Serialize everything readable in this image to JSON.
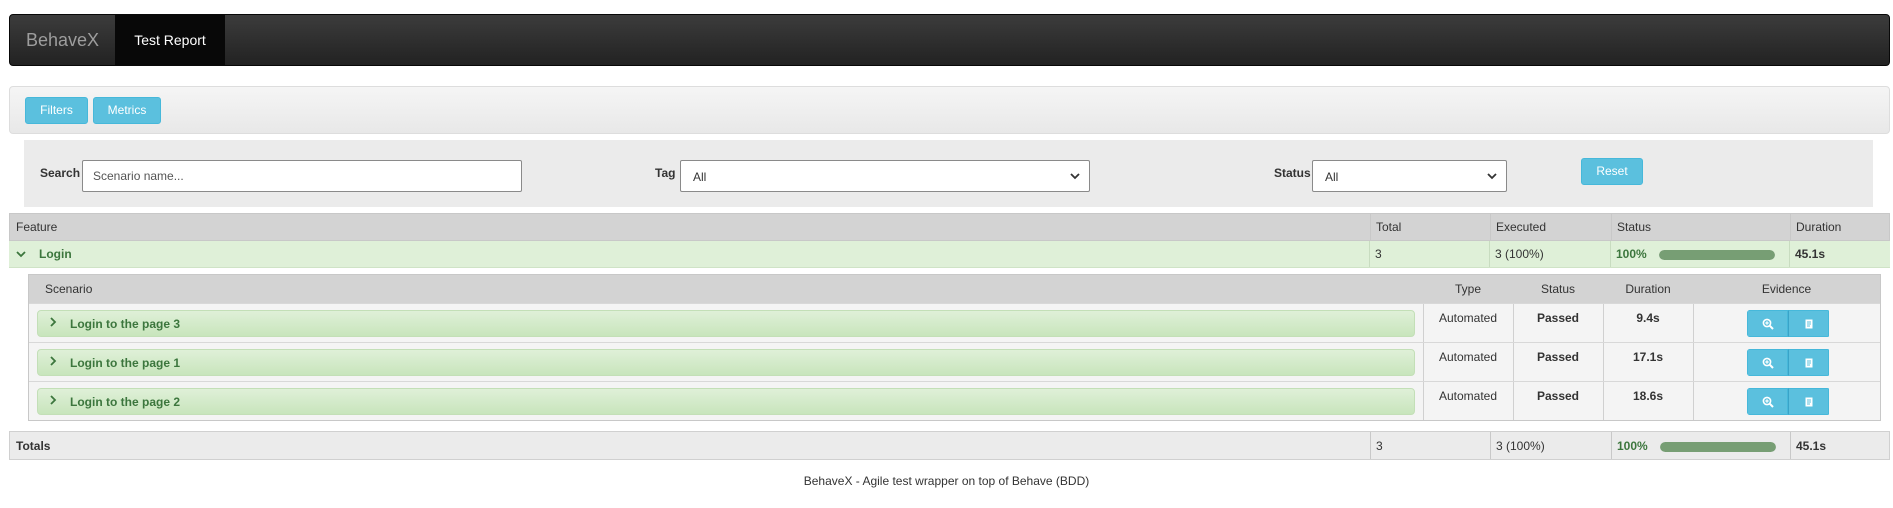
{
  "navbar": {
    "brand": "BehaveX",
    "active_tab": "Test Report"
  },
  "toolbar": {
    "filters_label": "Filters",
    "metrics_label": "Metrics"
  },
  "filters": {
    "search_label": "Search",
    "search_placeholder": "Scenario name...",
    "tag_label": "Tag",
    "tag_selected": "All",
    "status_label": "Status",
    "status_selected": "All",
    "reset_label": "Reset"
  },
  "features_table": {
    "headers": {
      "feature": "Feature",
      "total": "Total",
      "executed": "Executed",
      "status": "Status",
      "duration": "Duration"
    },
    "features": [
      {
        "name": "Login",
        "total": "3",
        "executed": "3 (100%)",
        "status_pct": "100%",
        "status_progress": 1.0,
        "duration": "45.1s",
        "expanded": true
      }
    ]
  },
  "scenarios_table": {
    "headers": {
      "scenario": "Scenario",
      "type": "Type",
      "status": "Status",
      "duration": "Duration",
      "evidence": "Evidence"
    },
    "rows": [
      {
        "name": "Login to the page 3",
        "type": "Automated",
        "status": "Passed",
        "duration": "9.4s"
      },
      {
        "name": "Login to the page 1",
        "type": "Automated",
        "status": "Passed",
        "duration": "17.1s"
      },
      {
        "name": "Login to the page 2",
        "type": "Automated",
        "status": "Passed",
        "duration": "18.6s"
      }
    ],
    "evidence_icons": [
      "search-plus-icon",
      "log-file-icon"
    ]
  },
  "totals": {
    "label": "Totals",
    "total": "3",
    "executed": "3 (100%)",
    "status_pct": "100%",
    "status_progress": 1.0,
    "duration": "45.1s"
  },
  "footer": {
    "text": "BehaveX - Agile test wrapper on top of Behave (BDD)"
  },
  "colors": {
    "info_button": "#5bc0de",
    "passed_row": "#dff0d8",
    "passed_text": "#3c763d",
    "progress_fill": "#779e74",
    "navbar": "#222222"
  }
}
